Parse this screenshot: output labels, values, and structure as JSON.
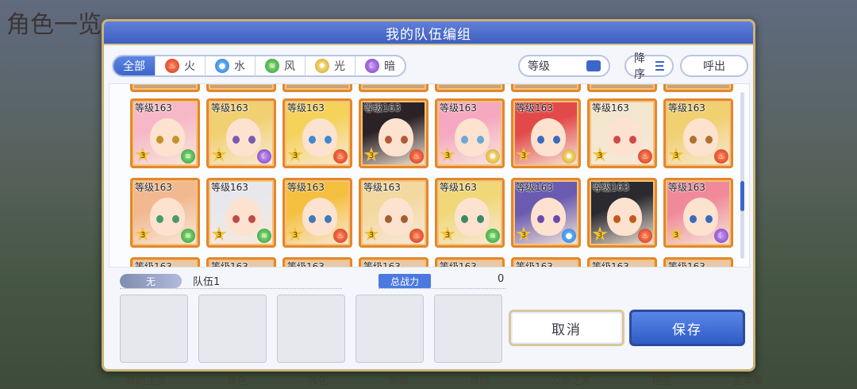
{
  "background": {
    "title": "角色一览",
    "nav": [
      "我的主页",
      "角色",
      "强化",
      "剧情",
      "冒险",
      "公会之家",
      "扭蛋",
      "主菜单"
    ]
  },
  "dialog": {
    "title": "我的队伍编组"
  },
  "filters": [
    {
      "label": "全部",
      "icon": "",
      "active": true
    },
    {
      "label": "火",
      "icon": "fire-icon",
      "active": false
    },
    {
      "label": "水",
      "icon": "water-icon",
      "active": false
    },
    {
      "label": "风",
      "icon": "wind-icon",
      "active": false
    },
    {
      "label": "光",
      "icon": "light-icon",
      "active": false
    },
    {
      "label": "暗",
      "icon": "dark-icon",
      "active": false
    }
  ],
  "sort": {
    "level_label": "等级",
    "desc_label": "降序",
    "call_label": "呼出"
  },
  "characters": [
    {
      "level": "等级163",
      "stars": "3",
      "element": "wind",
      "hair": "#f6b8c8",
      "eye": "#c9902a"
    },
    {
      "level": "等级163",
      "stars": "3",
      "element": "dark",
      "hair": "#f0d070",
      "eye": "#7a5ab0"
    },
    {
      "level": "等级163",
      "stars": "3",
      "element": "fire",
      "hair": "#f5d25a",
      "eye": "#3a8ad0"
    },
    {
      "level": "等级163",
      "stars": "3",
      "element": "fire",
      "hair": "#2a2226",
      "eye": "#b05a3a"
    },
    {
      "level": "等级163",
      "stars": "3",
      "element": "light",
      "hair": "#f5a8c0",
      "eye": "#6aa8d8"
    },
    {
      "level": "等级163",
      "stars": "3",
      "element": "light",
      "hair": "#e24a4a",
      "eye": "#3a6ac0"
    },
    {
      "level": "等级163",
      "stars": "3",
      "element": "fire",
      "hair": "#f3e6cf",
      "eye": "#d04a4a"
    },
    {
      "level": "等级163",
      "stars": "3",
      "element": "fire",
      "hair": "#f0d070",
      "eye": "#b07030"
    },
    {
      "level": "等级163",
      "stars": "3",
      "element": "wind",
      "hair": "#f2b890",
      "eye": "#4a9a6a"
    },
    {
      "level": "等级163",
      "stars": "3",
      "element": "wind",
      "hair": "#e8e8ec",
      "eye": "#c04a4a"
    },
    {
      "level": "等级163",
      "stars": "3",
      "element": "fire",
      "hair": "#f5c040",
      "eye": "#3a7ac0"
    },
    {
      "level": "等级163",
      "stars": "3",
      "element": "fire",
      "hair": "#f3d8a0",
      "eye": "#a06030"
    },
    {
      "level": "等级163",
      "stars": "3",
      "element": "wind",
      "hair": "#f0d878",
      "eye": "#3a8a6a"
    },
    {
      "level": "等级163",
      "stars": "3",
      "element": "water",
      "hair": "#6a5ab0",
      "eye": "#6a4ab0"
    },
    {
      "level": "等级163",
      "stars": "3",
      "element": "fire",
      "hair": "#2a2a30",
      "eye": "#c05a1a"
    },
    {
      "level": "等级163",
      "stars": "3",
      "element": "dark",
      "hair": "#f08a9a",
      "eye": "#3a6ac0"
    }
  ],
  "partial_row_level": "等级163",
  "party": {
    "tag": "无",
    "name": "队伍1",
    "power_label": "总战力",
    "power_value": "0"
  },
  "buttons": {
    "cancel": "取消",
    "save": "保存"
  }
}
